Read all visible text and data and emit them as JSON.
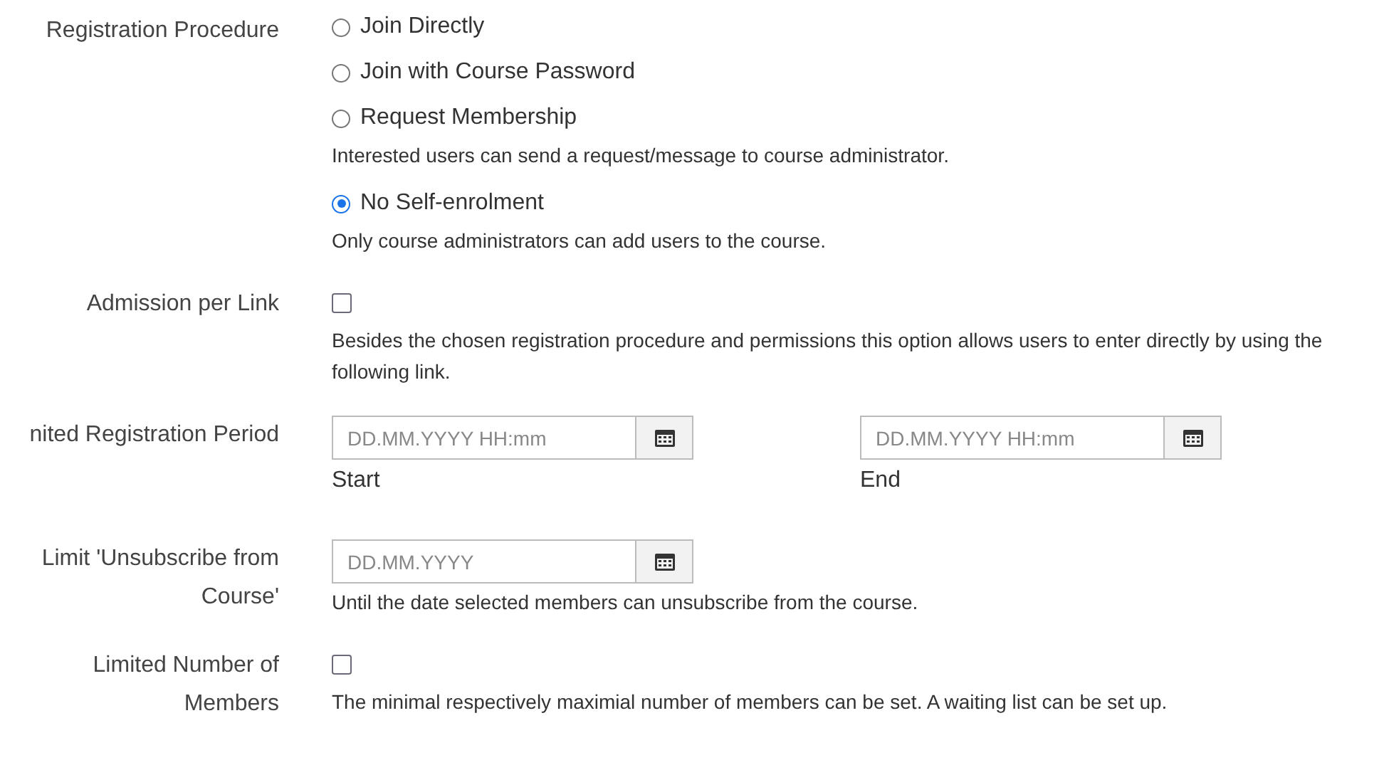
{
  "rows": [
    {
      "kind": "radios",
      "label": "Registration Procedure",
      "options": [
        {
          "label": "Join Directly",
          "selected": false
        },
        {
          "label": "Join with Course Password",
          "selected": false
        },
        {
          "label": "Request Membership",
          "selected": false,
          "help": "Interested users can send a request/message to course administrator."
        },
        {
          "label": "No Self-enrolment",
          "selected": true,
          "help": "Only course administrators can add users to the course."
        }
      ]
    },
    {
      "kind": "checkbox",
      "label": "Admission per Link",
      "checked": false,
      "help": "Besides the chosen registration procedure and permissions this option allows users to enter directly by using the following link."
    },
    {
      "kind": "daterange",
      "label": "nited Registration Period",
      "fields": [
        {
          "placeholder": "DD.MM.YYYY HH:mm",
          "caption": "Start"
        },
        {
          "placeholder": "DD.MM.YYYY HH:mm",
          "caption": "End"
        }
      ]
    },
    {
      "kind": "date",
      "label": "Limit 'Unsubscribe from Course'",
      "placeholder": "DD.MM.YYYY",
      "help": "Until the date selected members can unsubscribe from the course."
    },
    {
      "kind": "checkbox",
      "label": "Limited Number of Members",
      "checked": false,
      "help": "The minimal respectively maximial number of members can be set. A waiting list can be set up."
    }
  ]
}
